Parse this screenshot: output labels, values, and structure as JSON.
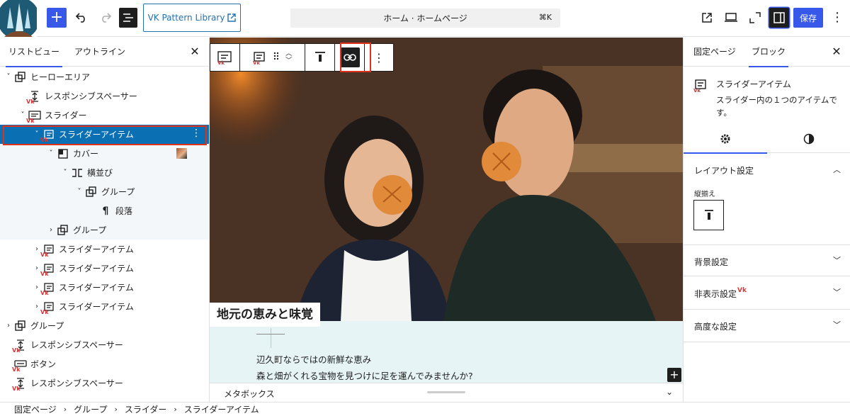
{
  "topbar": {
    "pattern_library_label": "VK Pattern Library",
    "command_bar_text": "ホーム · ホームページ",
    "command_bar_shortcut": "⌘K",
    "save_label": "保存"
  },
  "list_view": {
    "tabs": [
      "リストビュー",
      "アウトライン"
    ],
    "close_glyph": "✕",
    "items": [
      {
        "label": "ヒーローエリア",
        "indent": 0,
        "chev": "˅",
        "icon": "group",
        "state": "normal"
      },
      {
        "label": "レスポンシブスペーサー",
        "indent": 1,
        "chev": "",
        "icon": "spacer-vk",
        "state": "normal"
      },
      {
        "label": "スライダー",
        "indent": 1,
        "chev": "˅",
        "icon": "slider-vk",
        "state": "normal"
      },
      {
        "label": "スライダーアイテム",
        "indent": 2,
        "chev": "˅",
        "icon": "slider-item-vk",
        "state": "selected"
      },
      {
        "label": "カバー",
        "indent": 3,
        "chev": "˅",
        "icon": "cover",
        "state": "child",
        "thumb": true
      },
      {
        "label": "横並び",
        "indent": 4,
        "chev": "˅",
        "icon": "row",
        "state": "child"
      },
      {
        "label": "グループ",
        "indent": 5,
        "chev": "˅",
        "icon": "group",
        "state": "child"
      },
      {
        "label": "段落",
        "indent": 6,
        "chev": "",
        "icon": "paragraph",
        "state": "child"
      },
      {
        "label": "グループ",
        "indent": 3,
        "chev": "›",
        "icon": "group",
        "state": "child"
      },
      {
        "label": "スライダーアイテム",
        "indent": 2,
        "chev": "›",
        "icon": "slider-item-vk",
        "state": "normal"
      },
      {
        "label": "スライダーアイテム",
        "indent": 2,
        "chev": "›",
        "icon": "slider-item-vk",
        "state": "normal"
      },
      {
        "label": "スライダーアイテム",
        "indent": 2,
        "chev": "›",
        "icon": "slider-item-vk",
        "state": "normal"
      },
      {
        "label": "スライダーアイテム",
        "indent": 2,
        "chev": "›",
        "icon": "slider-item-vk",
        "state": "normal"
      },
      {
        "label": "グループ",
        "indent": 0,
        "chev": "›",
        "icon": "group",
        "state": "normal"
      },
      {
        "label": "レスポンシブスペーサー",
        "indent": 0,
        "chev": "",
        "icon": "spacer-vk",
        "state": "normal"
      },
      {
        "label": "ボタン",
        "indent": 0,
        "chev": "",
        "icon": "button-vk",
        "state": "normal"
      },
      {
        "label": "レスポンシブスペーサー",
        "indent": 0,
        "chev": "",
        "icon": "spacer-vk",
        "state": "normal"
      }
    ]
  },
  "canvas": {
    "caption_title": "地元の恵みと味覚",
    "caption_lines": [
      "辺久町ならではの新鮮な恵み",
      "森と畑がくれる宝物を見つけに足を運んでみませんか?"
    ],
    "metabox_label": "メタボックス"
  },
  "inspector": {
    "tabs": [
      "固定ページ",
      "ブロック"
    ],
    "close_glyph": "✕",
    "block_title": "スライダーアイテム",
    "block_description": "スライダー内の１つのアイテムです。",
    "sections": [
      "レイアウト設定",
      "背景設定",
      "非表示設定",
      "高度な設定"
    ],
    "valign_label": "縦揃え"
  },
  "breadcrumb": [
    "固定ページ",
    "グループ",
    "スライダー",
    "スライダーアイテム"
  ],
  "colors": {
    "accent": "#3858e9",
    "selected_row": "#0a6fb3",
    "highlight": "#e0321b",
    "vk_red": "#d63638"
  }
}
